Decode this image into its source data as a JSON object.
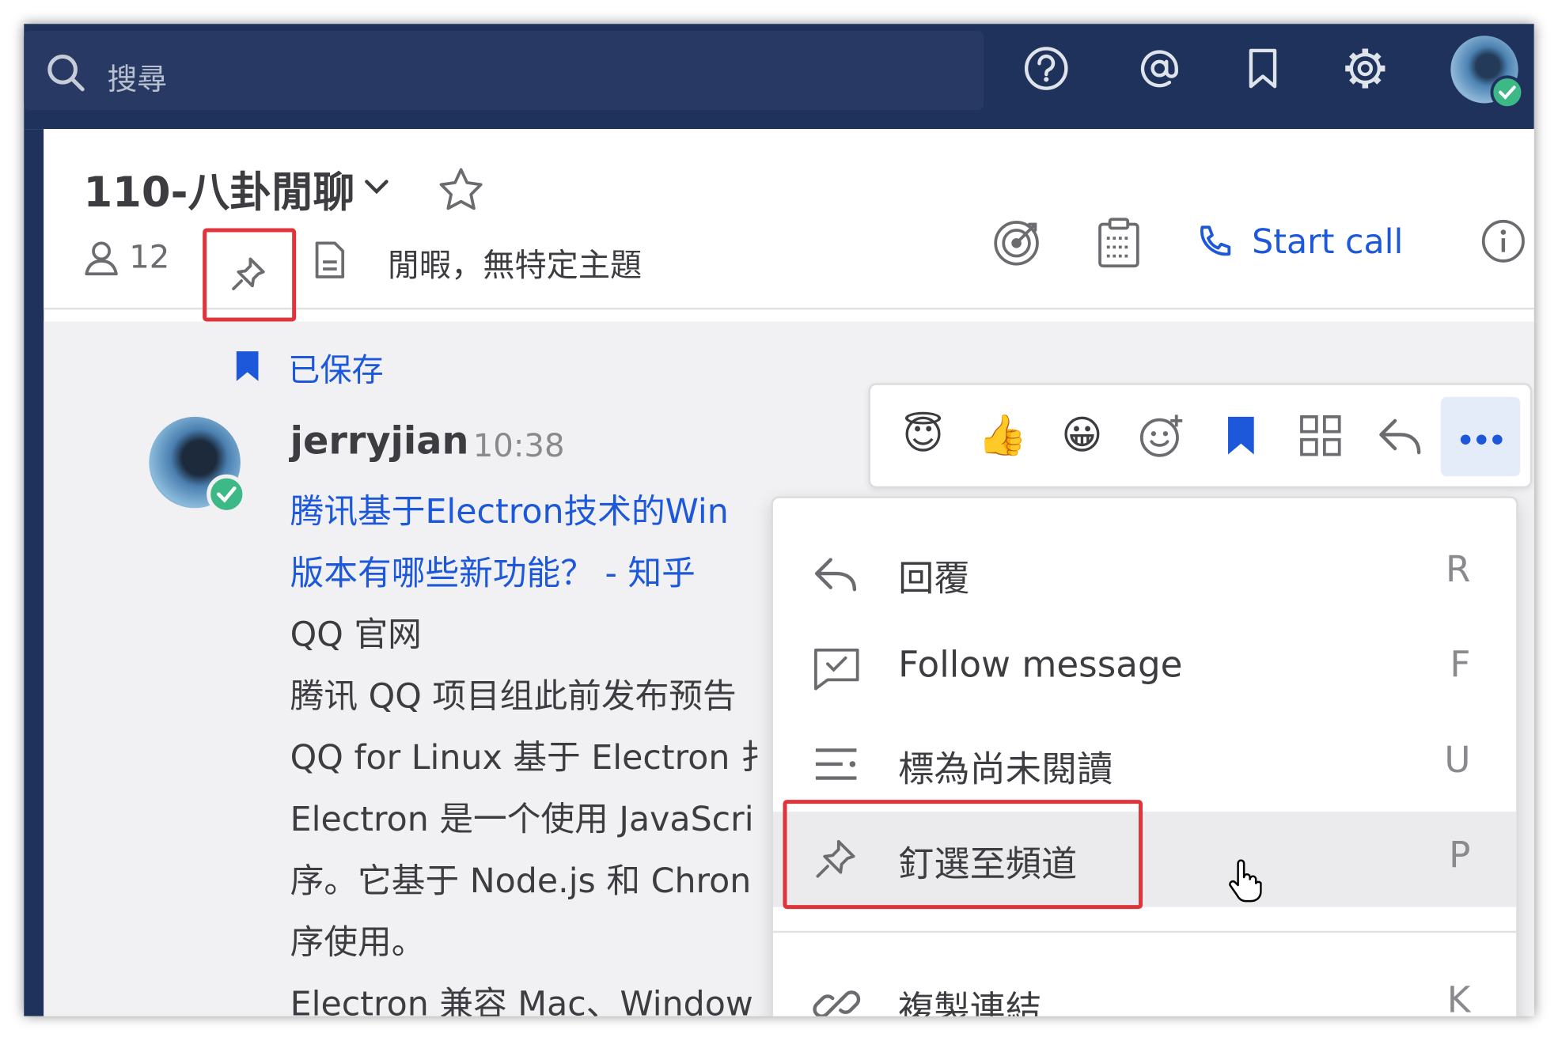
{
  "search": {
    "placeholder": "搜尋"
  },
  "topbar": {
    "icons": [
      "help-icon",
      "mention-icon",
      "saved-messages-icon",
      "settings-gear-icon"
    ],
    "user_status": "online"
  },
  "channel": {
    "name": "110-八卦閒聊",
    "member_count": "12",
    "purpose": "閒暇，無特定主題",
    "start_call_label": "Start call"
  },
  "post": {
    "saved_label": "已保存",
    "username": "jerryjian",
    "time": "10:38",
    "lines": [
      {
        "text": " 腾讯基于Electron技术的Win",
        "link": true
      },
      {
        "text": "版本有哪些新功能？ - 知乎",
        "link": true
      },
      {
        "text": "QQ 官网",
        "link": false
      },
      {
        "text": "腾讯 QQ 项目组此前发布预告",
        "link": false
      },
      {
        "text": "QQ for Linux 基于 Electron 扌",
        "link": false
      },
      {
        "text": "Electron 是一个使用 JavaScri",
        "link": false
      },
      {
        "text": "序。它基于 Node.js 和 Chron",
        "link": false
      },
      {
        "text": "序使用。",
        "link": false
      },
      {
        "text": "Electron 兼容 Mac、Window",
        "link": false
      }
    ]
  },
  "emoji_bar": {
    "items": [
      "😇",
      "👍",
      "😀"
    ],
    "icons": [
      "add-reaction-icon",
      "save-icon",
      "apps-icon",
      "reply-icon",
      "more-actions-icon"
    ]
  },
  "menu": {
    "items": [
      {
        "label": "回覆",
        "shortcut": "R"
      },
      {
        "label": "Follow message",
        "shortcut": "F"
      },
      {
        "label": "標為尚未閱讀",
        "shortcut": "U"
      },
      {
        "label": "釘選至頻道",
        "shortcut": "P"
      },
      {
        "label": "複製連結",
        "shortcut": "K"
      }
    ]
  },
  "colors": {
    "topbar": "#1e325c",
    "link": "#1c58d9",
    "highlight": "#e0343b",
    "online": "#3db887"
  }
}
